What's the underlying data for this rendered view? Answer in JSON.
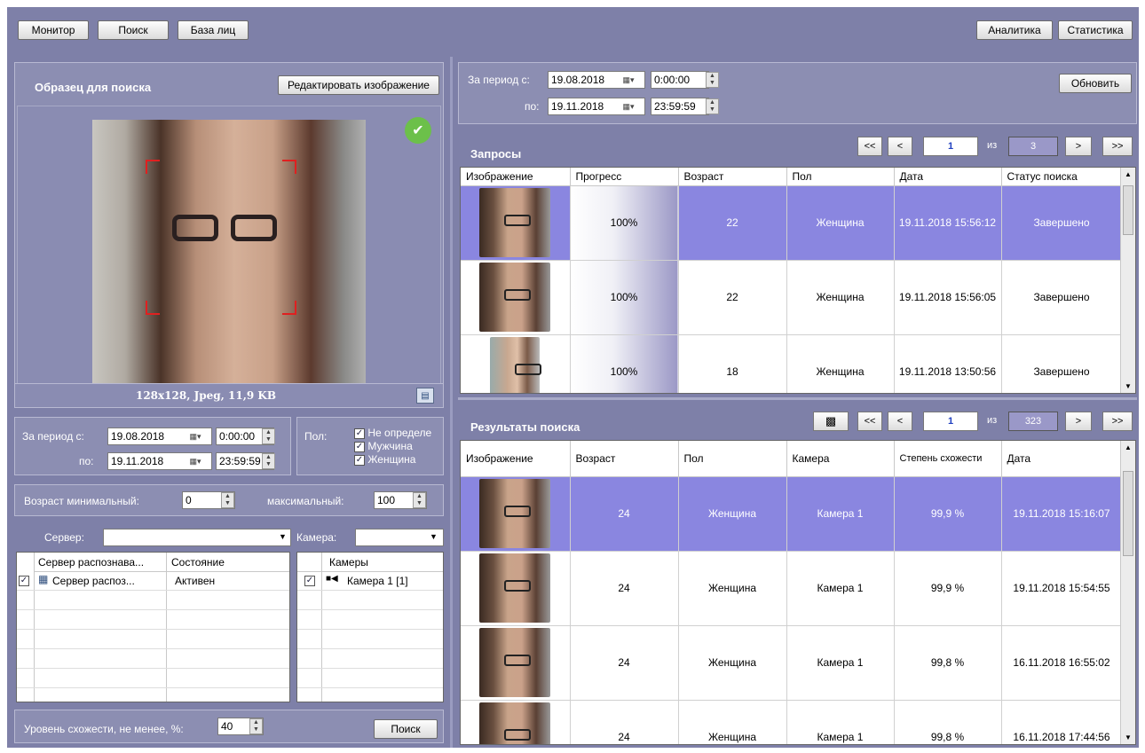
{
  "toolbar": {
    "left": [
      "Монитор",
      "Поиск",
      "База лиц"
    ],
    "right": [
      "Аналитика",
      "Статистика"
    ]
  },
  "sample": {
    "title": "Образец для поиска",
    "edit_button": "Редактировать изображение",
    "image_info": "128x128, Jpeg, 11,9 KB"
  },
  "left_filter": {
    "period_from_label": "За период с:",
    "period_to_label": "по:",
    "from_date": "19.08.2018",
    "from_time": "0:00:00",
    "to_date": "19.11.2018",
    "to_time": "23:59:59",
    "gender_label": "Пол:",
    "genders": [
      "Не определе",
      "Мужчина",
      "Женщина"
    ],
    "age_min_label": "Возраст минимальный:",
    "age_min": "0",
    "age_max_label": "максимальный:",
    "age_max": "100",
    "server_label": "Сервер:",
    "server_value": "",
    "camera_label": "Камера:",
    "camera_value": ""
  },
  "servers_table": {
    "headers": [
      "Сервер распознава...",
      "Состояние"
    ],
    "rows": [
      {
        "name": "Сервер распоз...",
        "state": "Активен"
      }
    ]
  },
  "cameras_table": {
    "header": "Камеры",
    "rows": [
      "Камера 1 [1]"
    ]
  },
  "similarity": {
    "label": "Уровень схожести, не менее, %:",
    "value": "40",
    "search_button": "Поиск"
  },
  "right_filter": {
    "period_from_label": "За период с:",
    "period_to_label": "по:",
    "from_date": "19.08.2018",
    "from_time": "0:00:00",
    "to_date": "19.11.2018",
    "to_time": "23:59:59",
    "refresh_button": "Обновить"
  },
  "requests": {
    "title": "Запросы",
    "pager": {
      "first": "<<",
      "prev": "<",
      "page": "1",
      "of": "из",
      "total": "3",
      "next": ">",
      "last": ">>"
    },
    "headers": [
      "Изображение",
      "Прогресс",
      "Возраст",
      "Пол",
      "Дата",
      "Статус поиска"
    ],
    "rows": [
      {
        "progress": "100%",
        "progress_value": 1.0,
        "age": "22",
        "gender": "Женщина",
        "date": "19.11.2018 15:56:12",
        "status": "Завершено"
      },
      {
        "progress": "100%",
        "progress_value": 1.0,
        "age": "22",
        "gender": "Женщина",
        "date": "19.11.2018 15:56:05",
        "status": "Завершено"
      },
      {
        "progress": "100%",
        "progress_value": 1.0,
        "age": "18",
        "gender": "Женщина",
        "date": "19.11.2018 13:50:56",
        "status": "Завершено"
      }
    ]
  },
  "results": {
    "title": "Результаты поиска",
    "pager": {
      "first": "<<",
      "prev": "<",
      "page": "1",
      "of": "из",
      "total": "323",
      "next": ">",
      "last": ">>"
    },
    "headers": [
      "Изображение",
      "Возраст",
      "Пол",
      "Камера",
      "Степень схожести",
      "Дата"
    ],
    "rows": [
      {
        "age": "24",
        "gender": "Женщина",
        "camera": "Камера 1",
        "similarity": "99,9 %",
        "date": "19.11.2018 15:16:07"
      },
      {
        "age": "24",
        "gender": "Женщина",
        "camera": "Камера 1",
        "similarity": "99,9 %",
        "date": "19.11.2018 15:54:55"
      },
      {
        "age": "24",
        "gender": "Женщина",
        "camera": "Камера 1",
        "similarity": "99,8 %",
        "date": "16.11.2018 16:55:02"
      },
      {
        "age": "24",
        "gender": "Женщина",
        "camera": "Камера 1",
        "similarity": "99,8 %",
        "date": "16.11.2018 17:44:56"
      }
    ]
  },
  "colors": {
    "background": "#7e80a8",
    "panel": "#8c8eb2",
    "selected_row": "#8a86e0",
    "accept_icon": "#6cc04a"
  }
}
